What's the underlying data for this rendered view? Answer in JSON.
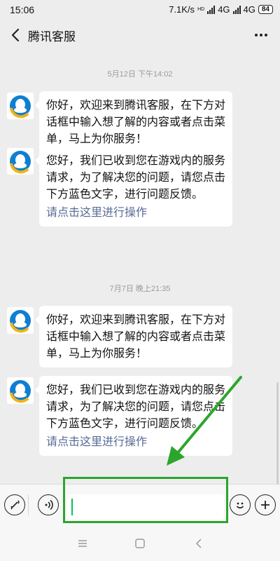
{
  "status_bar": {
    "time": "15:06",
    "speed": "7.1K/s",
    "network1": "4G",
    "network2": "4G",
    "net_tag": "HD",
    "battery": "84"
  },
  "header": {
    "title": "腾讯客服",
    "back_icon": "chevron-left-icon",
    "more_icon": "more-dots-icon"
  },
  "timestamps": [
    "5月12日 下午14:02",
    "7月7日 晚上21:35"
  ],
  "messages": [
    {
      "text": "你好，欢迎来到腾讯客服，在下方对话框中输入想了解的内容或者点击菜单，马上为你服务！",
      "link": ""
    },
    {
      "text": "您好，我们已收到您在游戏内的服务请求，为了解决您的问题，请您点击下方蓝色文字，进行问题反馈。",
      "link": "请点击这里进行操作"
    },
    {
      "text": "你好，欢迎来到腾讯客服，在下方对话框中输入想了解的内容或者点击菜单，马上为你服务！",
      "link": ""
    },
    {
      "text": "您好，我们已收到您在游戏内的服务请求，为了解决您的问题，请您点击下方蓝色文字，进行问题反馈。",
      "link": "请点击这里进行操作"
    }
  ],
  "input_bar": {
    "value": "",
    "icons": [
      "menu-switch-icon",
      "voice-icon",
      "emoji-icon",
      "add-icon"
    ]
  },
  "nav_bar": {
    "icons": [
      "menu-icon",
      "home-icon",
      "back-icon"
    ]
  },
  "colors": {
    "link": "#576b95",
    "annotation": "#2ca52c",
    "background": "#ededed"
  }
}
